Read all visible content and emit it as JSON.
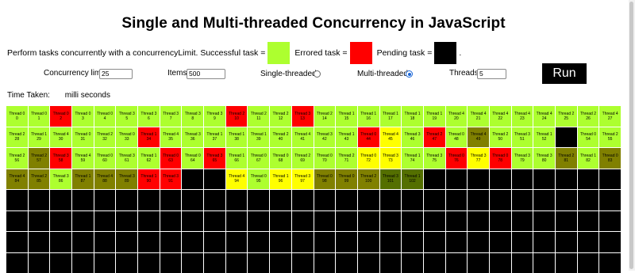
{
  "title": "Single and Multi-threaded Concurrency in JavaScript",
  "intro": {
    "text": "Perform tasks concurrently with a concurrencyLimit. Successful task =",
    "errored_label": "Errored task =",
    "pending_label": "Pending task =",
    "trailing": ".",
    "colors": {
      "success": "#adff2f",
      "error": "#ff0000",
      "pending": "#000000"
    }
  },
  "controls": {
    "concurrency_label": "Concurrency limit",
    "concurrency_value": "25",
    "items_label": "Items",
    "items_value": "500",
    "single_label": "Single-threaded",
    "multi_label": "Multi-threaded",
    "mode_selected": "multi",
    "threads_label": "Threads",
    "threads_value": "5",
    "run_label": "Run"
  },
  "time": {
    "label": "Time Taken:",
    "unit": "milli seconds"
  },
  "colors": {
    "g": "#adff2f",
    "r": "#ff0000",
    "b": "#000000",
    "o": "#808000",
    "y": "#ffff00",
    "d": "#546f00"
  },
  "grid": {
    "columns": 28,
    "empty_rows": 4,
    "tasks": [
      {
        "t": "Thread 0",
        "n": "0",
        "c": "g"
      },
      {
        "t": "Thread 0",
        "n": "1",
        "c": "g"
      },
      {
        "t": "Thread 0",
        "n": "2",
        "c": "r"
      },
      {
        "t": "Thread 0",
        "n": "3",
        "c": "g"
      },
      {
        "t": "Thread 0",
        "n": "4",
        "c": "g"
      },
      {
        "t": "Thread 3",
        "n": "5",
        "c": "g"
      },
      {
        "t": "Thread 3",
        "n": "6",
        "c": "g"
      },
      {
        "t": "Thread 3",
        "n": "7",
        "c": "g"
      },
      {
        "t": "Thread 3",
        "n": "8",
        "c": "g"
      },
      {
        "t": "Thread 3",
        "n": "9",
        "c": "g"
      },
      {
        "t": "Thread 2",
        "n": "10",
        "c": "r"
      },
      {
        "t": "Thread 2",
        "n": "11",
        "c": "g"
      },
      {
        "t": "Thread 2",
        "n": "12",
        "c": "g"
      },
      {
        "t": "Thread 3",
        "n": "13",
        "c": "r"
      },
      {
        "t": "Thread 2",
        "n": "14",
        "c": "g"
      },
      {
        "t": "Thread 1",
        "n": "15",
        "c": "g"
      },
      {
        "t": "Thread 1",
        "n": "16",
        "c": "g"
      },
      {
        "t": "Thread 1",
        "n": "17",
        "c": "g"
      },
      {
        "t": "Thread 1",
        "n": "18",
        "c": "g"
      },
      {
        "t": "Thread 1",
        "n": "19",
        "c": "g"
      },
      {
        "t": "Thread 4",
        "n": "20",
        "c": "g"
      },
      {
        "t": "Thread 4",
        "n": "21",
        "c": "g"
      },
      {
        "t": "Thread 4",
        "n": "22",
        "c": "g"
      },
      {
        "t": "Thread 4",
        "n": "23",
        "c": "g"
      },
      {
        "t": "Thread 4",
        "n": "24",
        "c": "g"
      },
      {
        "t": "Thread 2",
        "n": "25",
        "c": "g"
      },
      {
        "t": "Thread 2",
        "n": "26",
        "c": "g"
      },
      {
        "t": "Thread 4",
        "n": "27",
        "c": "g"
      },
      {
        "t": "Thread 2",
        "n": "28",
        "c": "g"
      },
      {
        "t": "Thread 1",
        "n": "29",
        "c": "g"
      },
      {
        "t": "Thread 4",
        "n": "30",
        "c": "g"
      },
      {
        "t": "Thread 0",
        "n": "31",
        "c": "g"
      },
      {
        "t": "Thread 2",
        "n": "32",
        "c": "g"
      },
      {
        "t": "Thread 0",
        "n": "33",
        "c": "g"
      },
      {
        "t": "Thread 1",
        "n": "34",
        "c": "r"
      },
      {
        "t": "Thread 4",
        "n": "35",
        "c": "g"
      },
      {
        "t": "Thread 3",
        "n": "36",
        "c": "g"
      },
      {
        "t": "Thread 1",
        "n": "37",
        "c": "g"
      },
      {
        "t": "Thread 1",
        "n": "38",
        "c": "g"
      },
      {
        "t": "Thread 1",
        "n": "39",
        "c": "g"
      },
      {
        "t": "Thread 2",
        "n": "40",
        "c": "g"
      },
      {
        "t": "Thread 4",
        "n": "41",
        "c": "g"
      },
      {
        "t": "Thread 3",
        "n": "42",
        "c": "g"
      },
      {
        "t": "Thread 1",
        "n": "43",
        "c": "g"
      },
      {
        "t": "Thread 0",
        "n": "44",
        "c": "r"
      },
      {
        "t": "Thread 4",
        "n": "45",
        "c": "y"
      },
      {
        "t": "Thread 3",
        "n": "46",
        "c": "g"
      },
      {
        "t": "Thread 2",
        "n": "47",
        "c": "r"
      },
      {
        "t": "Thread 0",
        "n": "48",
        "c": "g"
      },
      {
        "t": "Thread 4",
        "n": "49",
        "c": "o"
      },
      {
        "t": "Thread 2",
        "n": "50",
        "c": "g"
      },
      {
        "t": "Thread 3",
        "n": "51",
        "c": "g"
      },
      {
        "t": "Thread 1",
        "n": "52",
        "c": "g"
      },
      {
        "t": "",
        "n": "",
        "c": "b"
      },
      {
        "t": "Thread 0",
        "n": "54",
        "c": "g"
      },
      {
        "t": "Thread 2",
        "n": "55",
        "c": "g"
      },
      {
        "t": "Thread 2",
        "n": "56",
        "c": "g"
      },
      {
        "t": "Thread 2",
        "n": "57",
        "c": "o"
      },
      {
        "t": "Thread 3",
        "n": "58",
        "c": "r"
      },
      {
        "t": "Thread 4",
        "n": "59",
        "c": "g"
      },
      {
        "t": "Thread 0",
        "n": "60",
        "c": "g"
      },
      {
        "t": "Thread 3",
        "n": "61",
        "c": "g"
      },
      {
        "t": "Thread 1",
        "n": "62",
        "c": "g"
      },
      {
        "t": "Thread 0",
        "n": "63",
        "c": "r"
      },
      {
        "t": "Thread 0",
        "n": "64",
        "c": "g"
      },
      {
        "t": "Thread 3",
        "n": "65",
        "c": "r"
      },
      {
        "t": "Thread 1",
        "n": "66",
        "c": "g"
      },
      {
        "t": "Thread 0",
        "n": "67",
        "c": "g"
      },
      {
        "t": "Thread 0",
        "n": "68",
        "c": "g"
      },
      {
        "t": "Thread 2",
        "n": "69",
        "c": "g"
      },
      {
        "t": "Thread 0",
        "n": "70",
        "c": "g"
      },
      {
        "t": "Thread 2",
        "n": "71",
        "c": "g"
      },
      {
        "t": "Thread 0",
        "n": "72",
        "c": "y"
      },
      {
        "t": "Thread 3",
        "n": "73",
        "c": "y"
      },
      {
        "t": "Thread 1",
        "n": "74",
        "c": "g"
      },
      {
        "t": "Thread 3",
        "n": "75",
        "c": "g"
      },
      {
        "t": "Thread 0",
        "n": "76",
        "c": "r"
      },
      {
        "t": "Thread 3",
        "n": "77",
        "c": "y"
      },
      {
        "t": "Thread 0",
        "n": "78",
        "c": "r"
      },
      {
        "t": "Thread 3",
        "n": "79",
        "c": "g"
      },
      {
        "t": "Thread 3",
        "n": "80",
        "c": "g"
      },
      {
        "t": "Thread 2",
        "n": "81",
        "c": "o"
      },
      {
        "t": "Thread 1",
        "n": "82",
        "c": "g"
      },
      {
        "t": "Thread 0",
        "n": "83",
        "c": "o"
      },
      {
        "t": "Thread 4",
        "n": "84",
        "c": "o"
      },
      {
        "t": "Thread 2",
        "n": "85",
        "c": "o"
      },
      {
        "t": "Thread 3",
        "n": "86",
        "c": "g"
      },
      {
        "t": "Thread 1",
        "n": "87",
        "c": "o"
      },
      {
        "t": "Thread 4",
        "n": "88",
        "c": "o"
      },
      {
        "t": "Thread 3",
        "n": "89",
        "c": "o"
      },
      {
        "t": "Thread 1",
        "n": "90",
        "c": "r"
      },
      {
        "t": "Thread 3",
        "n": "91",
        "c": "r"
      },
      {
        "t": "",
        "n": "",
        "c": "b"
      },
      {
        "t": "",
        "n": "",
        "c": "b"
      },
      {
        "t": "Thread 4",
        "n": "94",
        "c": "y"
      },
      {
        "t": "Thread 0",
        "n": "95",
        "c": "g"
      },
      {
        "t": "Thread 1",
        "n": "96",
        "c": "y"
      },
      {
        "t": "Thread 3",
        "n": "97",
        "c": "y"
      },
      {
        "t": "Thread 0",
        "n": "98",
        "c": "o"
      },
      {
        "t": "Thread 0",
        "n": "99",
        "c": "o"
      },
      {
        "t": "Thread 2",
        "n": "100",
        "c": "o"
      },
      {
        "t": "Thread 3",
        "n": "101",
        "c": "d"
      },
      {
        "t": "Thread 1",
        "n": "102",
        "c": "d"
      }
    ]
  }
}
